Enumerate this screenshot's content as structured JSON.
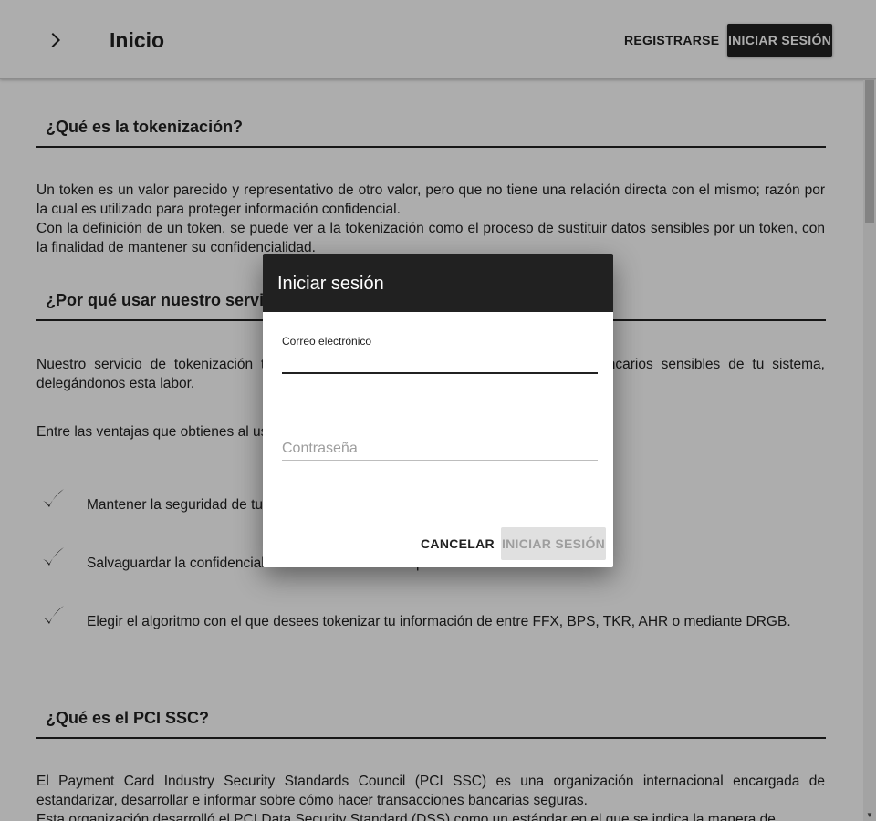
{
  "header": {
    "title": "Inicio",
    "register_label": "REGISTRARSE",
    "login_label": "INICIAR SESIÓN"
  },
  "content": {
    "section1": {
      "heading": "¿Qué es la tokenización?",
      "paragraph1": "Un token es un valor parecido y representativo de otro valor, pero que no tiene una relación directa con el mismo; razón por la cual es utilizado para proteger información confidencial.",
      "paragraph2": "Con la definición de un token, se puede ver a la tokenización como el proceso de sustituir datos sensibles por un token, con la finalidad de mantener su confidencialidad."
    },
    "section2": {
      "heading": "¿Por qué usar nuestro servicio?",
      "paragraph1": "Nuestro servicio de tokenización te permite eliminar el almacenamiento de datos bancarios sensibles de tu sistema, delegándonos esta labor.",
      "paragraph2": "Entre las ventajas que obtienes al usar nuestro servicio se encuentran:",
      "benefits": [
        "Mantener la seguridad de tu información bajo los estándares del PCI SSC.",
        "Salvaguardar la confidencialidad de datos sensibles por medio de la tokenización.",
        "Elegir el algoritmo con el que desees tokenizar tu información de entre FFX, BPS, TKR, AHR o mediante DRGB."
      ]
    },
    "section3": {
      "heading": "¿Qué es el PCI SSC?",
      "p1_prefix": "El ",
      "p1_link": "Payment Card Industry Security Standards Council (PCI SSC)",
      "p1_suffix": " es una organización internacional encargada de estandarizar, desarrollar e informar sobre cómo hacer transacciones bancarias seguras.",
      "p2_prefix": "Esta organización desarrolló el ",
      "p2_link": "PCI Data Security Standard (DSS)",
      "p2_suffix": " como un estándar en el que se indica la manera de"
    }
  },
  "dialog": {
    "title": "Iniciar sesión",
    "email_label": "Correo electrónico",
    "email_value": "",
    "password_placeholder": "Contraseña",
    "cancel_label": "CANCELAR",
    "submit_label": "INICIAR SESIÓN"
  },
  "icons": {
    "menu": "chevron-right-icon",
    "check": "checkmark-icon"
  },
  "colors": {
    "primary": "#212121",
    "overlay": "rgba(0,0,0,0.32)",
    "disabled_bg": "#e0e0e0",
    "disabled_text": "#9e9e9e"
  }
}
